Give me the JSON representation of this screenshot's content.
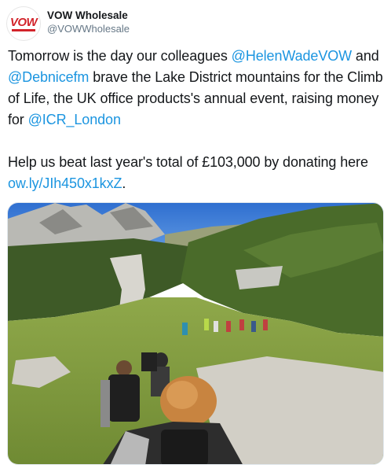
{
  "author": {
    "display_name": "VOW Wholesale",
    "handle": "@VOWWholesale",
    "avatar_logo_text": "VOW",
    "avatar_icon": "vow-logo-icon",
    "brand_color": "#d2232a"
  },
  "tweet": {
    "p1": {
      "t1": "Tomorrow is the day our colleagues ",
      "m1": "@HelenWadeVOW",
      "t2": " and ",
      "m2": "@Debnicefm",
      "t3": " brave the Lake District mountains for the Climb of Life, the UK office products's annual event, raising money for ",
      "m3": "@ICR_London"
    },
    "p2": {
      "t1": "Help us beat last year's total of £103,000 by donating here  ",
      "link": "ow.ly/JIh450x1kxZ",
      "t2": "."
    }
  },
  "media": {
    "type": "photo",
    "icon": "mountain-hikers-photo"
  },
  "colors": {
    "link": "#1b95e0",
    "text": "#14171a",
    "secondary": "#657786"
  }
}
